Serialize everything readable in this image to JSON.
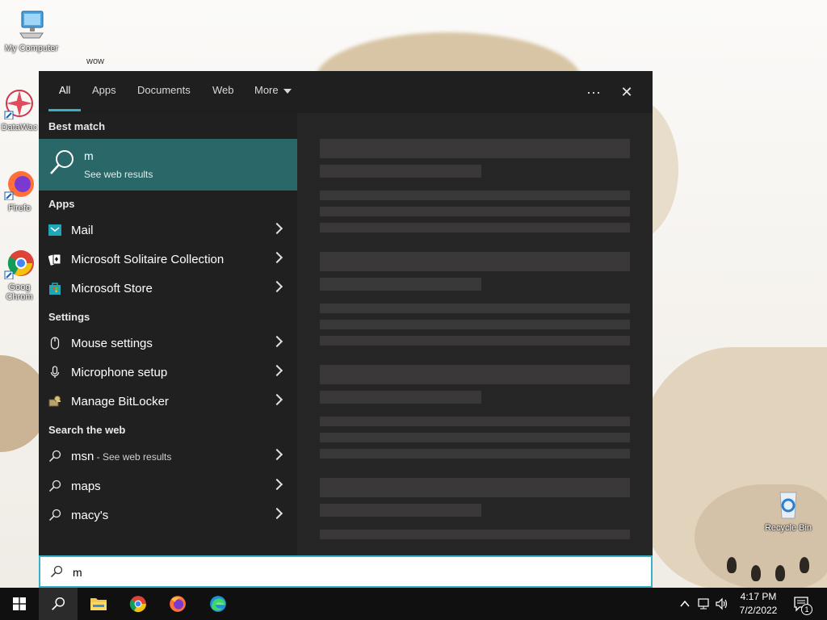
{
  "desktop": {
    "icons": [
      {
        "label": "My Computer"
      },
      {
        "label": "DataWac"
      },
      {
        "label": "Firefo"
      },
      {
        "label": "Goog Chrom"
      },
      {
        "label": "Recycle Bin"
      }
    ],
    "loose_label": "wow"
  },
  "search_panel": {
    "tabs": [
      {
        "label": "All",
        "active": true
      },
      {
        "label": "Apps"
      },
      {
        "label": "Documents"
      },
      {
        "label": "Web"
      },
      {
        "label": "More"
      }
    ],
    "more_options_label": "···",
    "close_label": "✕",
    "best_match": {
      "heading": "Best match",
      "title": "m",
      "subtitle": "See web results"
    },
    "apps": {
      "heading": "Apps",
      "items": [
        {
          "label": "Mail",
          "icon": "mail-icon"
        },
        {
          "label": "Microsoft Solitaire Collection",
          "icon": "solitaire-icon"
        },
        {
          "label": "Microsoft Store",
          "icon": "store-icon"
        }
      ]
    },
    "settings": {
      "heading": "Settings",
      "items": [
        {
          "label": "Mouse settings",
          "icon": "mouse-icon"
        },
        {
          "label": "Microphone setup",
          "icon": "microphone-icon"
        },
        {
          "label": "Manage BitLocker",
          "icon": "bitlocker-icon"
        }
      ]
    },
    "web": {
      "heading": "Search the web",
      "items": [
        {
          "label": "msn",
          "hint": " - See web results"
        },
        {
          "label": "maps",
          "hint": ""
        },
        {
          "label": "macy's",
          "hint": ""
        }
      ]
    },
    "search_box": {
      "value": "m"
    }
  },
  "taskbar": {
    "clock_time": "4:17 PM",
    "clock_date": "7/2/2022",
    "notification_count": "1"
  },
  "colors": {
    "accent": "#3ab0c8",
    "best_match_bg": "#2a6769",
    "panel_bg": "#202020",
    "taskbar_bg": "#101010"
  }
}
